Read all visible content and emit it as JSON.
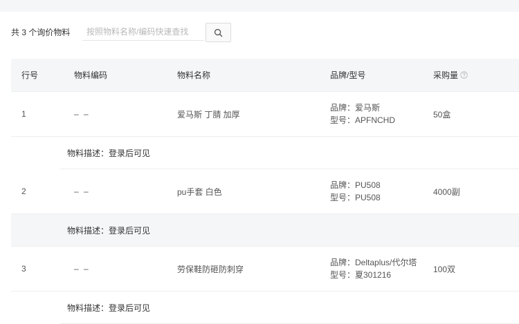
{
  "toolbar": {
    "count_label": "共 3 个询价物料",
    "search_placeholder": "按照物料名称/编码快速查找"
  },
  "table": {
    "headers": {
      "no": "行号",
      "code": "物料编码",
      "name": "物料名称",
      "brand": "品牌/型号",
      "qty": "采购量"
    },
    "rows": [
      {
        "no": "1",
        "code": "– –",
        "name": "爱马斯 丁腈 加厚",
        "brand": "品牌：爱马斯",
        "model": "型号：APFNCHD",
        "qty": "50盒",
        "desc": "物料描述：登录后可见"
      },
      {
        "no": "2",
        "code": "– –",
        "name": "pu手套 白色",
        "brand": "品牌：PU508",
        "model": "型号：PU508",
        "qty": "4000副",
        "desc": "物料描述：登录后可见"
      },
      {
        "no": "3",
        "code": "– –",
        "name": "劳保鞋防砸防刺穿",
        "brand": "品牌：Deltaplus/代尔塔",
        "model": "型号：夏301216",
        "qty": "100双",
        "desc": "物料描述：登录后可见"
      }
    ]
  }
}
